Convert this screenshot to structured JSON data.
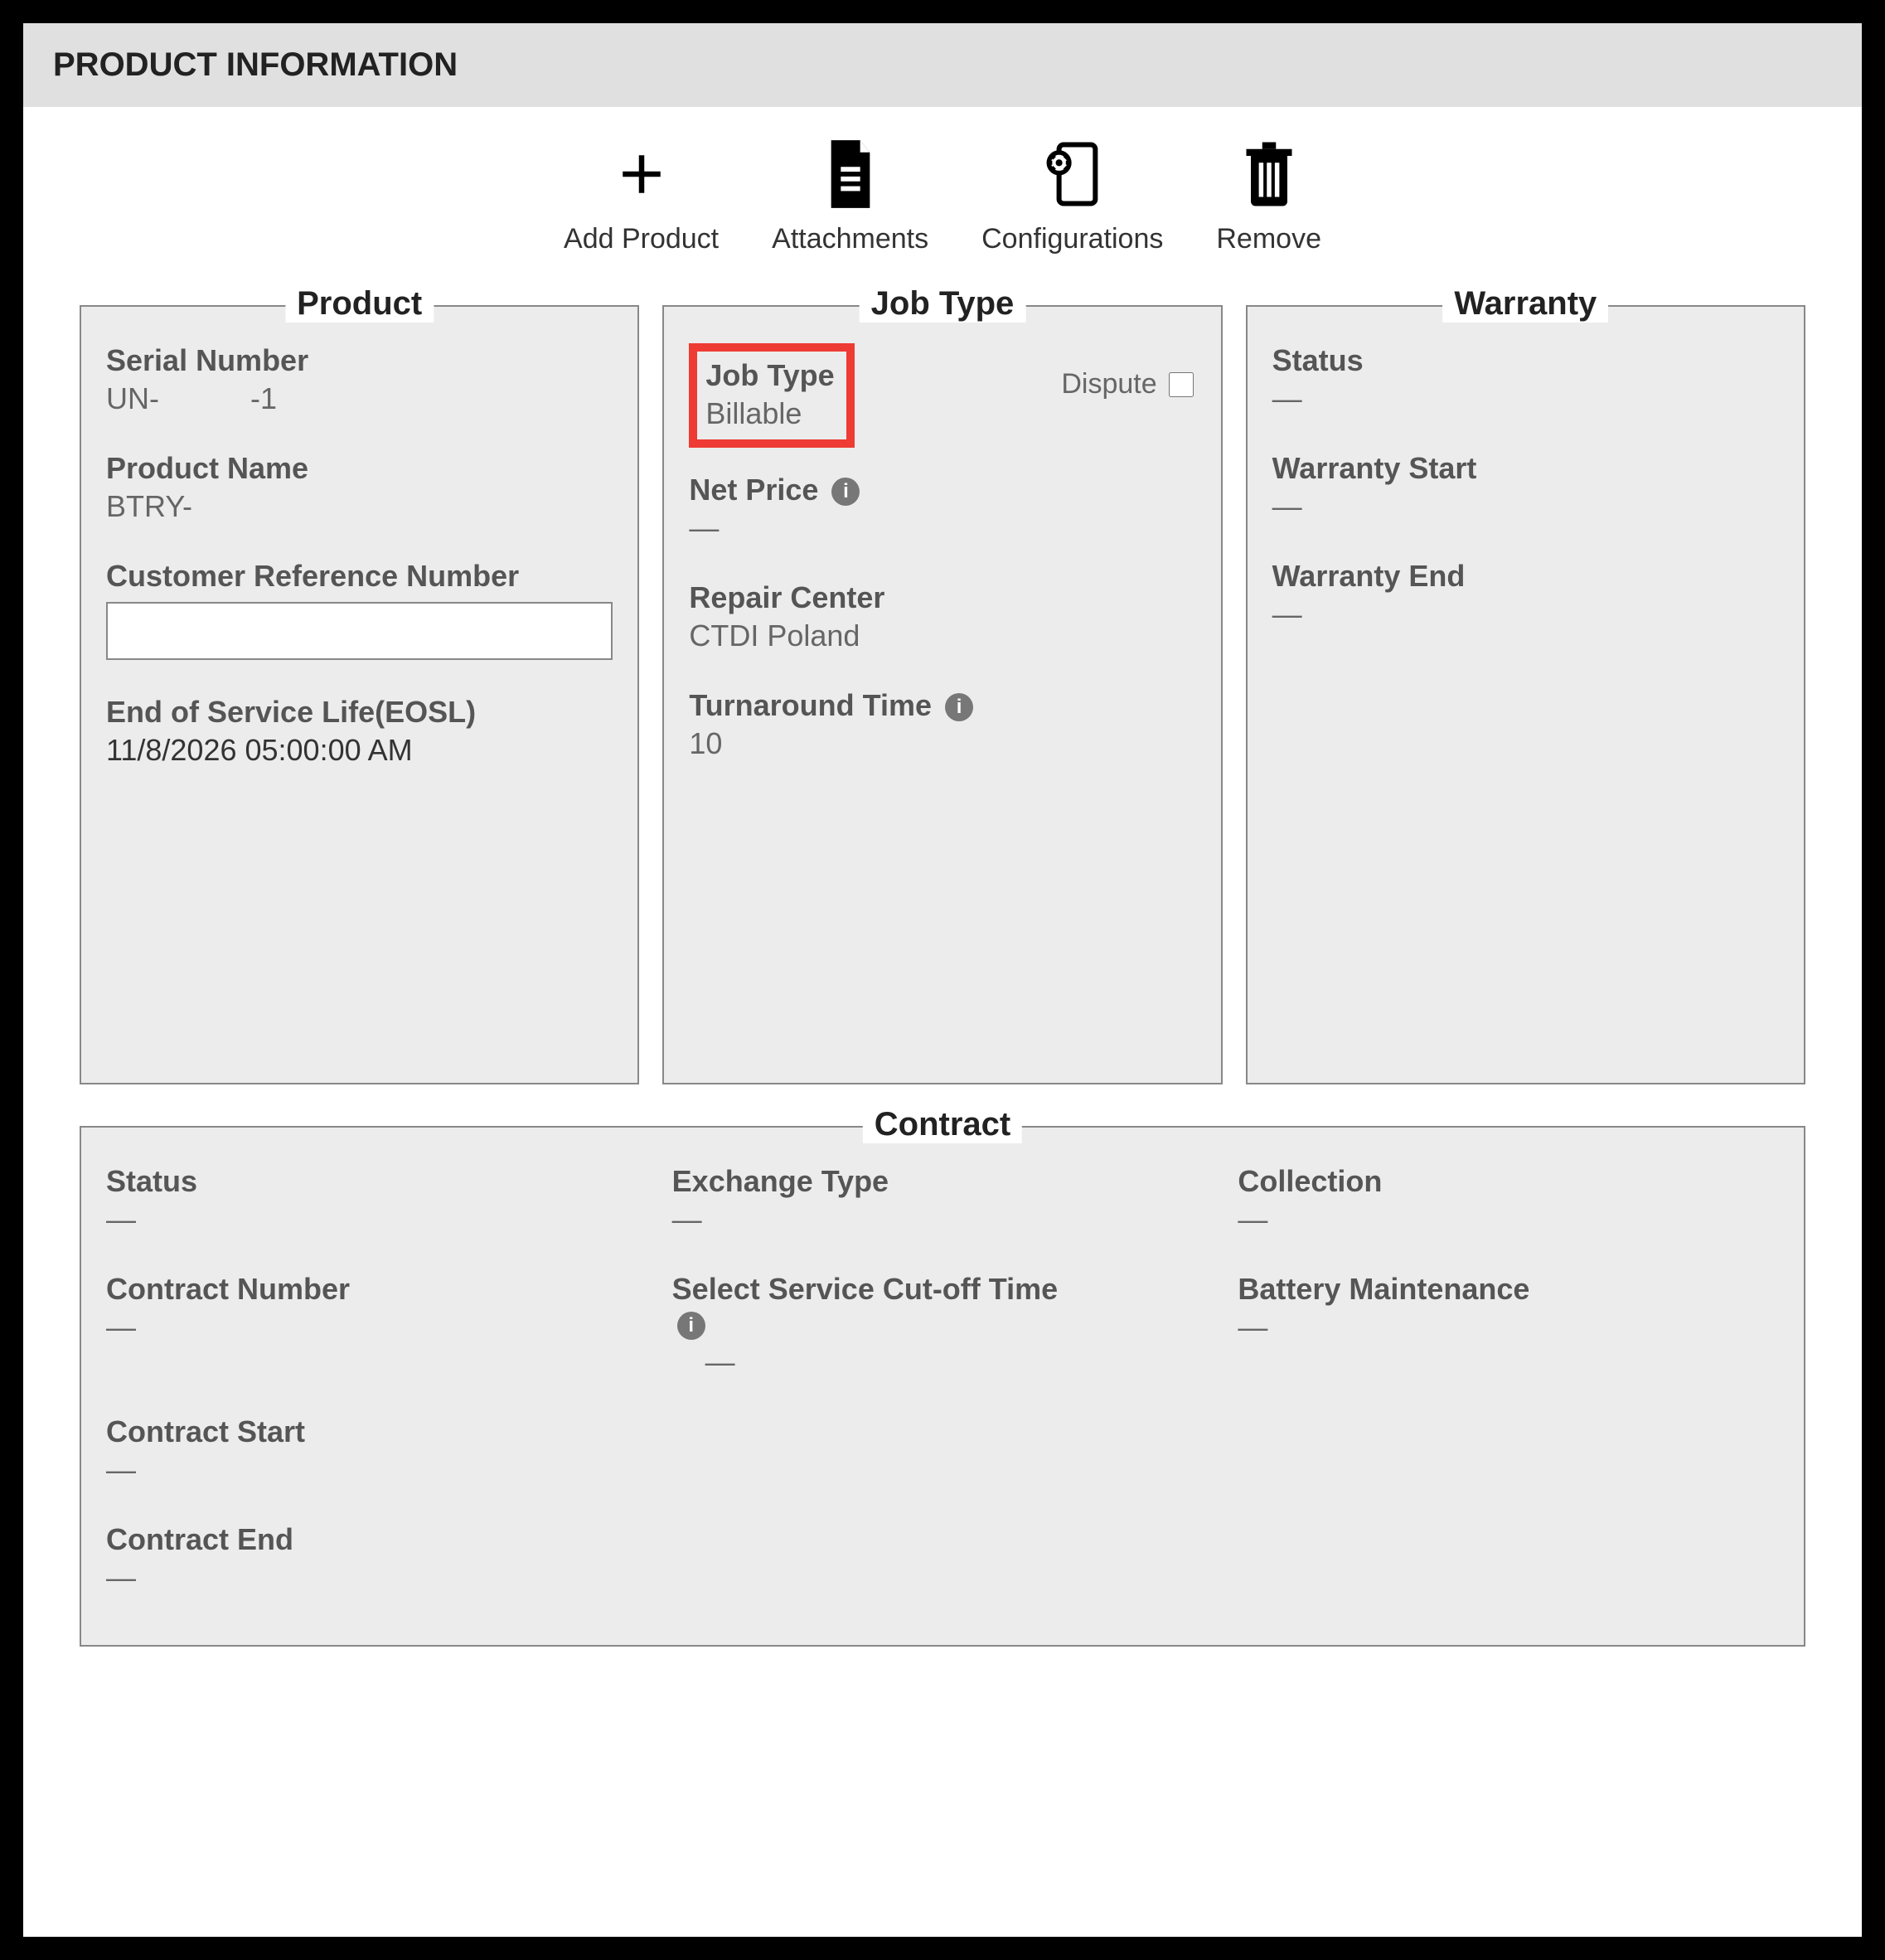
{
  "header": {
    "title": "PRODUCT INFORMATION"
  },
  "toolbar": {
    "add_product": "Add Product",
    "attachments": "Attachments",
    "configurations": "Configurations",
    "remove": "Remove"
  },
  "panels": {
    "product": {
      "legend": "Product",
      "serial_number_label": "Serial Number",
      "serial_number_value": "UN-           -1",
      "product_name_label": "Product Name",
      "product_name_value": "BTRY-",
      "cust_ref_label": "Customer Reference Number",
      "cust_ref_value": "",
      "eosl_label": "End of Service Life(EOSL)",
      "eosl_value": "11/8/2026 05:00:00 AM"
    },
    "job_type": {
      "legend": "Job Type",
      "job_type_label": "Job Type",
      "job_type_value": "Billable",
      "dispute_label": "Dispute",
      "net_price_label": "Net Price",
      "net_price_value": "—",
      "repair_center_label": "Repair Center",
      "repair_center_value": "CTDI Poland",
      "turnaround_label": "Turnaround Time",
      "turnaround_value": "10"
    },
    "warranty": {
      "legend": "Warranty",
      "status_label": "Status",
      "status_value": "—",
      "start_label": "Warranty Start",
      "start_value": "—",
      "end_label": "Warranty End",
      "end_value": "—"
    }
  },
  "contract": {
    "legend": "Contract",
    "status_label": "Status",
    "status_value": "—",
    "exchange_label": "Exchange Type",
    "exchange_value": "—",
    "collection_label": "Collection",
    "collection_value": "—",
    "number_label": "Contract Number",
    "number_value": "—",
    "cutoff_label": "Select Service Cut-off Time",
    "cutoff_value": "—",
    "battery_label": "Battery Maintenance",
    "battery_value": "—",
    "start_label": "Contract Start",
    "start_value": "—",
    "end_label": "Contract End",
    "end_value": "—"
  }
}
